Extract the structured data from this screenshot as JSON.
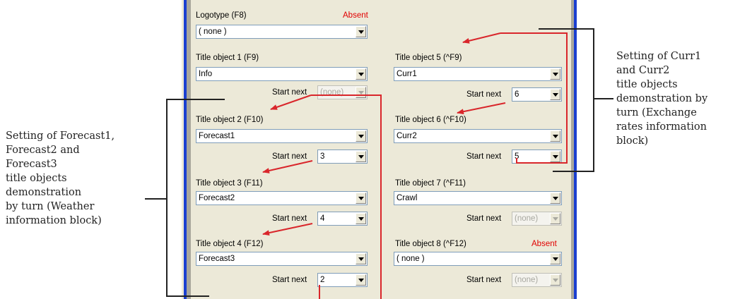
{
  "fields": {
    "logotype": {
      "label": "Logotype (F8)",
      "status": "Absent",
      "value": "( none )"
    },
    "t1": {
      "label": "Title object 1 (F9)",
      "value": "Info",
      "start_next": "(none)"
    },
    "t2": {
      "label": "Title object 2 (F10)",
      "value": "Forecast1",
      "start_next": "3"
    },
    "t3": {
      "label": "Title object 3 (F11)",
      "value": "Forecast2",
      "start_next": "4"
    },
    "t4": {
      "label": "Title object 4 (F12)",
      "value": "Forecast3",
      "start_next": "2"
    },
    "t5": {
      "label": "Title object 5 (^F9)",
      "value": "Curr1",
      "start_next": "6"
    },
    "t6": {
      "label": "Title object 6 (^F10)",
      "value": "Curr2",
      "start_next": "5"
    },
    "t7": {
      "label": "Title object 7 (^F11)",
      "value": "Crawl",
      "start_next": "(none)"
    },
    "t8": {
      "label": "Title object 8 (^F12)",
      "status": "Absent",
      "value": "( none )",
      "start_next": "(none)"
    }
  },
  "start_next_label": "Start next",
  "annotations": {
    "left": [
      "Setting of Forecast1,",
      "Forecast2 and",
      "Forecast3",
      "title objects",
      "demonstration",
      "by turn (Weather",
      "information block)"
    ],
    "right": [
      "Setting of Curr1",
      "and Curr2",
      "title objects",
      "demonstration by",
      "turn (Exchange",
      "rates information",
      "block)"
    ]
  },
  "colors": {
    "arrow": "#d9262b",
    "panel_bg": "#ece9d8",
    "edge_blue": "#1a3fd0",
    "absent": "#e00000"
  }
}
